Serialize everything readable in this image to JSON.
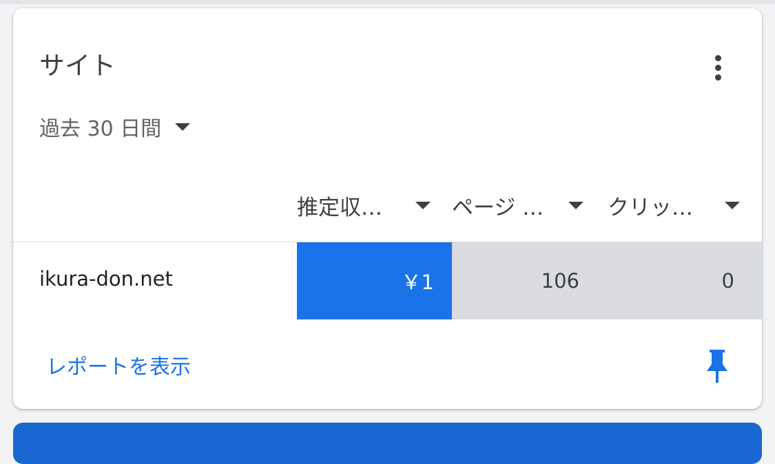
{
  "card": {
    "title": "サイト",
    "date_range": "過去 30 日間",
    "columns": [
      {
        "label": "推定収…"
      },
      {
        "label": "ページ …"
      },
      {
        "label": "クリッ…"
      }
    ],
    "rows": [
      {
        "site": "ikura-don.net",
        "revenue": "￥1",
        "pageviews": "106",
        "clicks": "0"
      }
    ],
    "report_link": "レポートを表示"
  },
  "colors": {
    "accent": "#1a73e8",
    "bar_secondary": "#dadce0",
    "bottom_card": "#1967d2"
  },
  "icons": {
    "more": "more-vert-icon",
    "pin": "pin-icon",
    "caret": "arrow-drop-down-icon"
  }
}
